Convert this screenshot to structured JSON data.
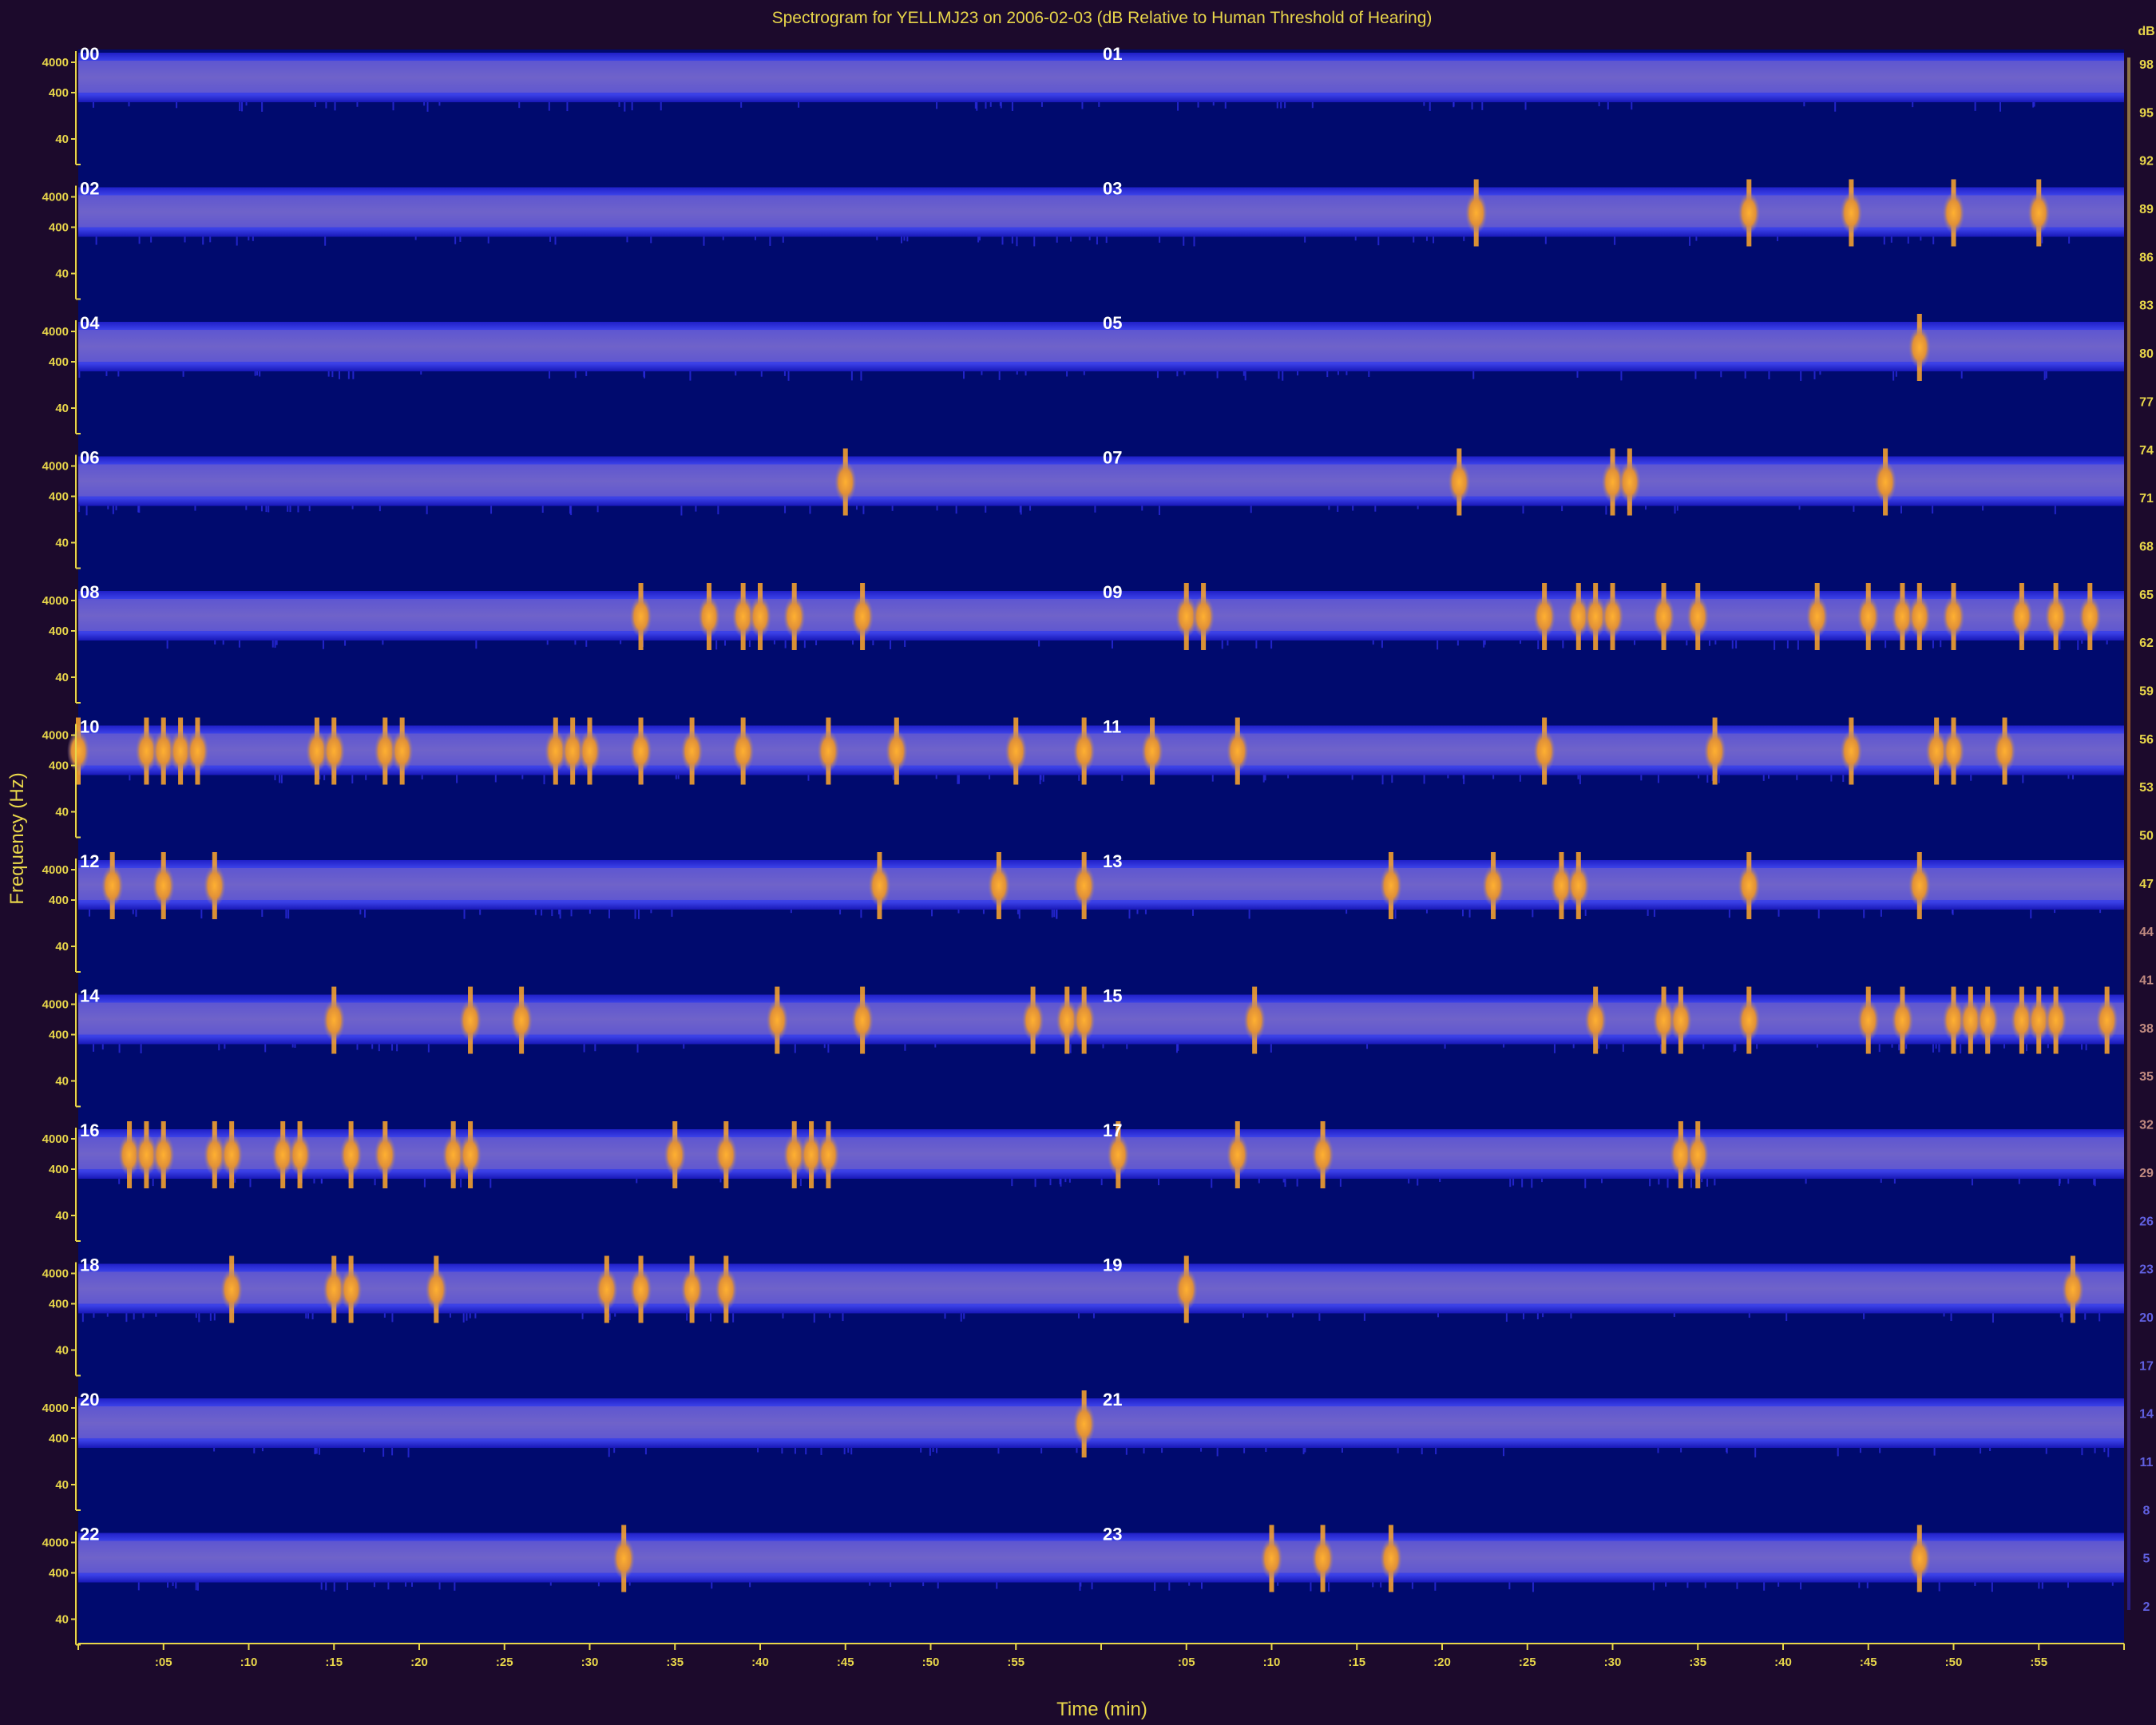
{
  "chart_data": {
    "type": "heatmap",
    "title": "Spectrogram for YELLMJ23 on 2006-02-03 (dB Relative to Human Threshold of Hearing)",
    "xlabel": "Time (min)",
    "ylabel": "Frequency (Hz)",
    "x_ticks": [
      ":05",
      ":10",
      ":15",
      ":20",
      ":25",
      ":30",
      ":35",
      ":40",
      ":45",
      ":50",
      ":55"
    ],
    "y_ticks": [
      "4000",
      "400",
      "40"
    ],
    "hour_labels": [
      "00",
      "01",
      "02",
      "03",
      "04",
      "05",
      "06",
      "07",
      "08",
      "09",
      "10",
      "11",
      "12",
      "13",
      "14",
      "15",
      "16",
      "17",
      "18",
      "19",
      "20",
      "21",
      "22",
      "23"
    ],
    "colorbar_ticks": [
      98,
      95,
      92,
      89,
      86,
      83,
      80,
      77,
      74,
      71,
      68,
      65,
      62,
      59,
      56,
      53,
      50,
      47,
      44,
      41,
      38,
      35,
      32,
      29,
      26,
      23,
      20,
      17,
      14,
      11,
      8,
      5,
      2
    ],
    "colorbar_unit": "dB",
    "layout": "12 rows x 2 columns, each panel one hour (0-60 min)",
    "colors": {
      "background": "#000a6e",
      "band": "#3a3ad8",
      "hot": "#ffa82a",
      "axis": "#e8d64a",
      "frame": "#1c0a2c"
    },
    "events": [
      {
        "hour": 3,
        "minutes": [
          22,
          38,
          44,
          50,
          55
        ]
      },
      {
        "hour": 5,
        "minutes": [
          48
        ]
      },
      {
        "hour": 6,
        "minutes": [
          45
        ]
      },
      {
        "hour": 7,
        "minutes": [
          21,
          30,
          31,
          46
        ]
      },
      {
        "hour": 8,
        "minutes": [
          33,
          37,
          39,
          40,
          42,
          46
        ]
      },
      {
        "hour": 9,
        "minutes": [
          5,
          6,
          26,
          28,
          29,
          30,
          33,
          35,
          42,
          45,
          47,
          48,
          50,
          54,
          56,
          58
        ]
      },
      {
        "hour": 10,
        "minutes": [
          0,
          4,
          5,
          6,
          7,
          14,
          15,
          18,
          19,
          28,
          29,
          30,
          33,
          36,
          39,
          44,
          48,
          55,
          59
        ]
      },
      {
        "hour": 11,
        "minutes": [
          3,
          8,
          26,
          36,
          44,
          49,
          50,
          53
        ]
      },
      {
        "hour": 12,
        "minutes": [
          2,
          5,
          8,
          47,
          54,
          59
        ]
      },
      {
        "hour": 13,
        "minutes": [
          17,
          23,
          27,
          28,
          38,
          48
        ]
      },
      {
        "hour": 14,
        "minutes": [
          15,
          23,
          26,
          41,
          46,
          56,
          58,
          59
        ]
      },
      {
        "hour": 15,
        "minutes": [
          9,
          29,
          33,
          34,
          38,
          45,
          47,
          50,
          51,
          52,
          54,
          55,
          56,
          59
        ]
      },
      {
        "hour": 16,
        "minutes": [
          3,
          4,
          5,
          8,
          9,
          12,
          13,
          16,
          18,
          22,
          23,
          35,
          38,
          42,
          43,
          44
        ]
      },
      {
        "hour": 17,
        "minutes": [
          1,
          8,
          13,
          34,
          35
        ]
      },
      {
        "hour": 18,
        "minutes": [
          9,
          15,
          16,
          21,
          31,
          33,
          36,
          38
        ]
      },
      {
        "hour": 19,
        "minutes": [
          5,
          57
        ]
      },
      {
        "hour": 20,
        "minutes": [
          59
        ]
      },
      {
        "hour": 22,
        "minutes": [
          32
        ]
      },
      {
        "hour": 23,
        "minutes": [
          10,
          13,
          17,
          48
        ]
      }
    ]
  }
}
